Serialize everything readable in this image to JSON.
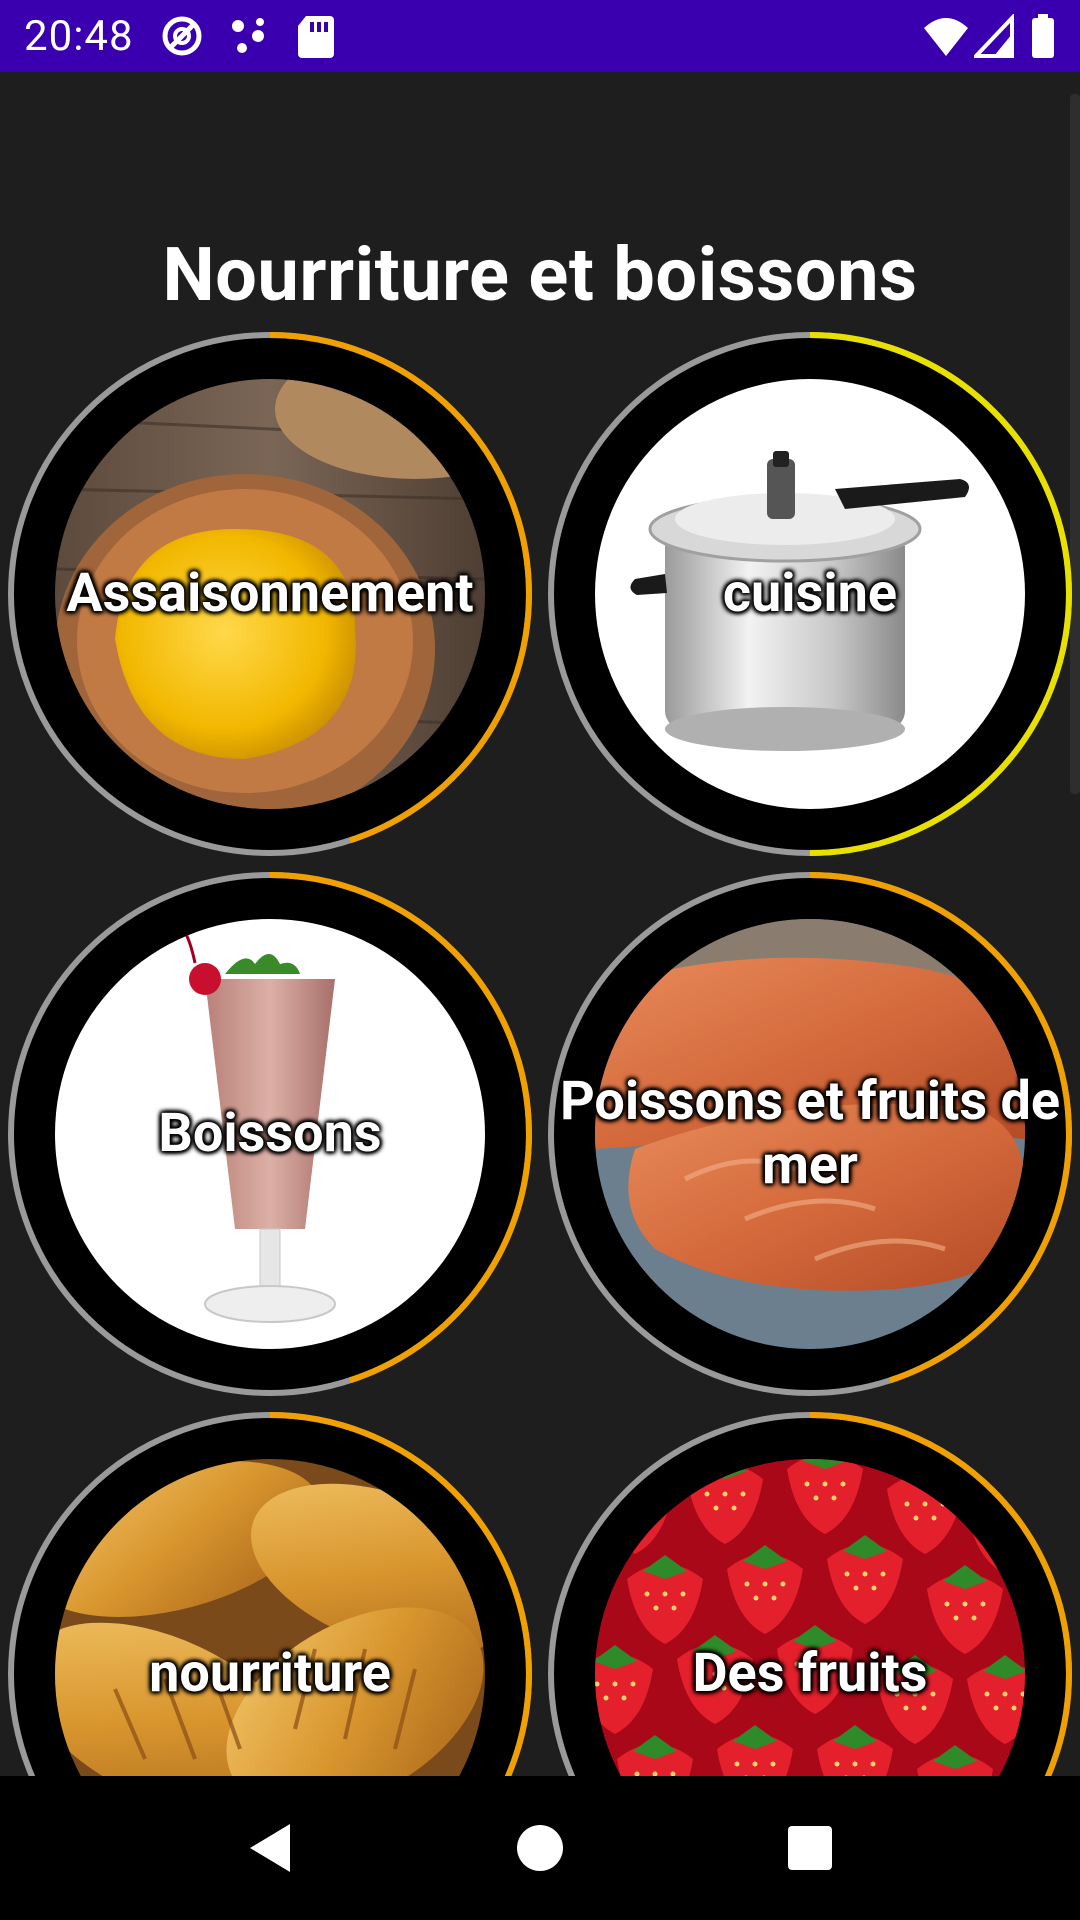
{
  "status_bar": {
    "time": "20:48",
    "left_icons": [
      "at-sign-icon",
      "dots-icon",
      "sd-card-icon"
    ],
    "right_icons": [
      "wifi-icon",
      "cell-signal-icon",
      "battery-icon"
    ],
    "background": "#3a00b0"
  },
  "page": {
    "title": "Nourriture et boissons",
    "background": "#1e1e1e"
  },
  "categories": [
    {
      "label": "Assaisonnement",
      "image": "mustard-bowl",
      "progress": 0.45,
      "ring_color": "#f0a000"
    },
    {
      "label": "cuisine",
      "image": "pressure-cooker",
      "progress": 0.5,
      "ring_color": "#e8e000"
    },
    {
      "label": "Boissons",
      "image": "milkshake",
      "progress": 0.45,
      "ring_color": "#f0a000"
    },
    {
      "label": "Poissons et fruits de mer",
      "image": "salmon-fillet",
      "progress": 0.45,
      "ring_color": "#f0a000"
    },
    {
      "label": "nourriture",
      "image": "croissants",
      "progress": 0.45,
      "ring_color": "#f0a000"
    },
    {
      "label": "Des fruits",
      "image": "strawberries",
      "progress": 0.45,
      "ring_color": "#f0a000"
    }
  ],
  "nav_bar": {
    "buttons": [
      "back-icon",
      "home-icon",
      "recents-icon"
    ]
  }
}
